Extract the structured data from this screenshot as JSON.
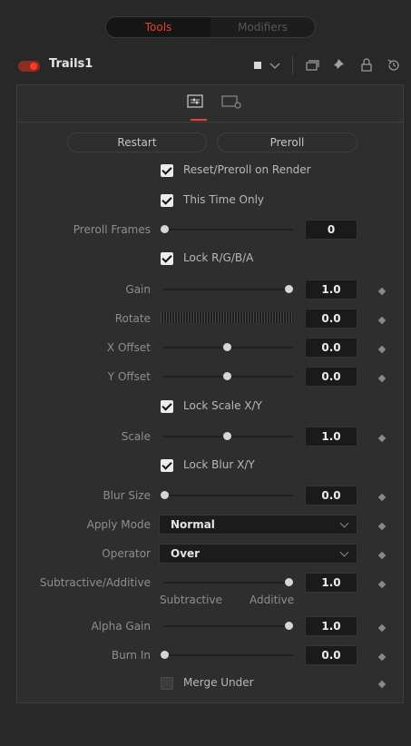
{
  "tabs": {
    "active": "Tools",
    "inactive": "Modifiers"
  },
  "tool": {
    "name": "Trails1"
  },
  "buttons": {
    "restart": "Restart",
    "preroll": "Preroll"
  },
  "checkboxes": {
    "reset_preroll": {
      "label": "Reset/Preroll on Render",
      "checked": true
    },
    "this_time_only": {
      "label": "This Time Only",
      "checked": true
    },
    "lock_rgba": {
      "label": "Lock R/G/B/A",
      "checked": true
    },
    "lock_scale": {
      "label": "Lock Scale X/Y",
      "checked": true
    },
    "lock_blur": {
      "label": "Lock Blur X/Y",
      "checked": true
    },
    "merge_under": {
      "label": "Merge Under",
      "checked": false
    }
  },
  "params": {
    "preroll_frames": {
      "label": "Preroll Frames",
      "value": "0",
      "level": 0.0
    },
    "gain": {
      "label": "Gain",
      "value": "1.0",
      "level": 1.0
    },
    "rotate": {
      "label": "Rotate",
      "value": "0.0"
    },
    "x_offset": {
      "label": "X Offset",
      "value": "0.0",
      "level": 0.5
    },
    "y_offset": {
      "label": "Y Offset",
      "value": "0.0",
      "level": 0.5
    },
    "scale": {
      "label": "Scale",
      "value": "1.0",
      "level": 0.5
    },
    "blur_size": {
      "label": "Blur Size",
      "value": "0.0",
      "level": 0.0
    },
    "sub_add": {
      "label": "Subtractive/Additive",
      "value": "1.0",
      "level": 1.0,
      "left_label": "Subtractive",
      "right_label": "Additive"
    },
    "alpha_gain": {
      "label": "Alpha Gain",
      "value": "1.0",
      "level": 1.0
    },
    "burn_in": {
      "label": "Burn In",
      "value": "0.0",
      "level": 0.0
    }
  },
  "selects": {
    "apply_mode": {
      "label": "Apply Mode",
      "value": "Normal"
    },
    "operator": {
      "label": "Operator",
      "value": "Over"
    }
  },
  "colors": {
    "accent": "#e8412e",
    "toggle_on": "#ff3a28"
  }
}
